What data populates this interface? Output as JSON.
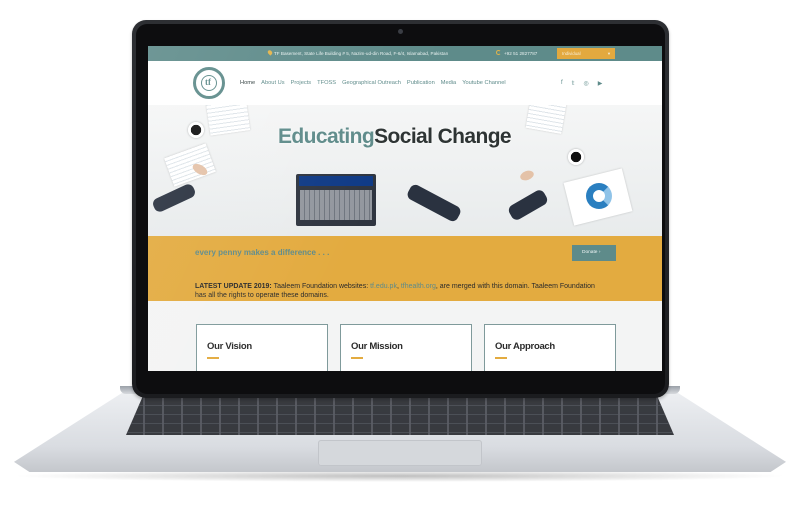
{
  "topbar": {
    "address": "TF Basement, State Life Building # 5, Nazim-ud-din Road, F-6/4, Islamabad, Pakistan",
    "phone": "+92 51 2827787",
    "select_label": "Individual"
  },
  "nav": {
    "items": [
      "Home",
      "About Us",
      "Projects",
      "TFOSS",
      "Geographical Outreach",
      "Publication",
      "Media",
      "Youtube Channel"
    ],
    "active": "Home"
  },
  "social": [
    "facebook-icon",
    "twitter-icon",
    "instagram-icon",
    "youtube-icon"
  ],
  "hero": {
    "title_part1": "Educating",
    "title_part2": "Social Change"
  },
  "band": {
    "slogan": "every penny makes a difference . . .",
    "donate_label": "Donate",
    "update_lead": "LATEST UPDATE 2019:",
    "update_text1": " Taaleem Foundation websites: ",
    "link1": "tf.edu.pk",
    "comma": ", ",
    "link2": "tfhealth.org",
    "update_text2": ", are merged with this domain. Taaleem Foundation has all the rights to operate these domains."
  },
  "cards": [
    "Our Vision",
    "Our Mission",
    "Our Approach"
  ],
  "colors": {
    "teal": "#5e8b8a",
    "gold": "#e3ab40"
  }
}
